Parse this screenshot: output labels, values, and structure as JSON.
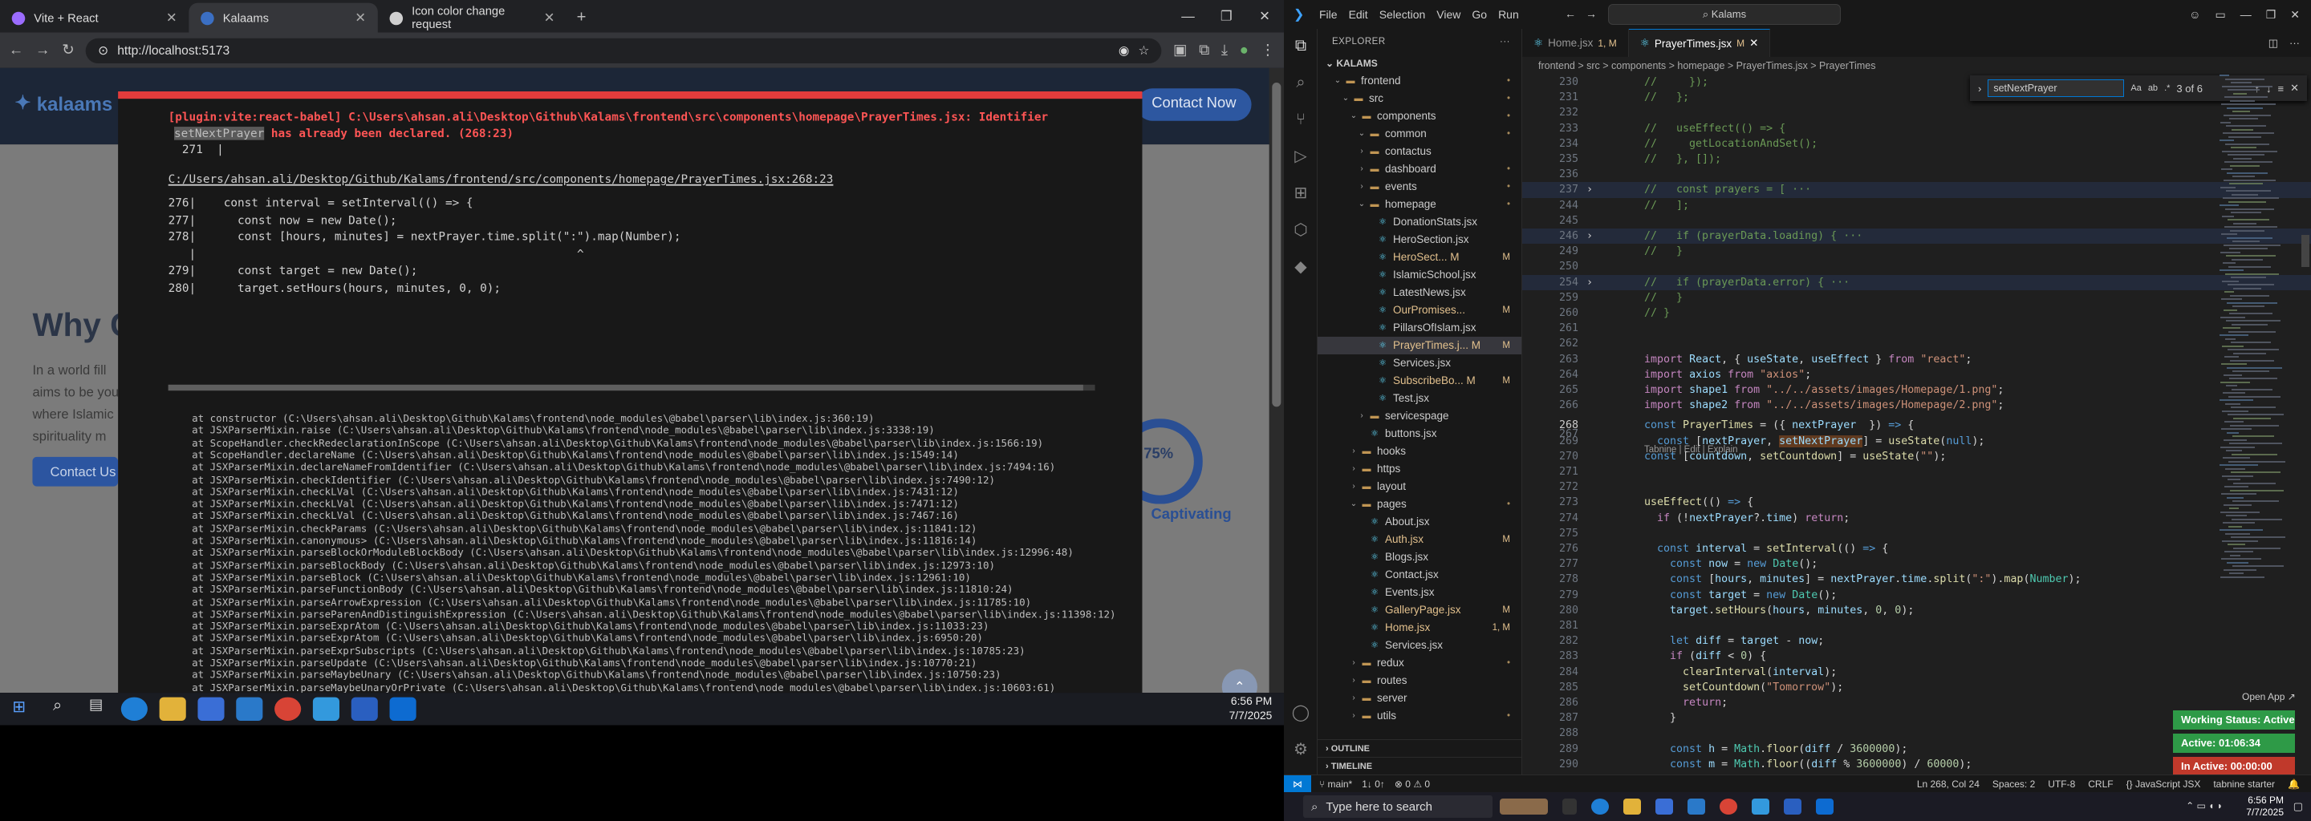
{
  "browser": {
    "tabs": [
      {
        "label": "Vite + React",
        "color": "#9b6cff"
      },
      {
        "label": "Kalaams",
        "color": "#3b6fc3"
      },
      {
        "label": "Icon color change request",
        "color": "#cfcfcf"
      }
    ],
    "url": "http://localhost:5173"
  },
  "site": {
    "logo": "kalaams",
    "contact_button": "Contact Now",
    "hero_title": "Why C",
    "hero_text": "In a world fill aims to be you where Islamic spirituality m",
    "hero_button": "Contact Us",
    "stat_value": "75%",
    "stat_label": "Captivating"
  },
  "overlay": {
    "plugin": "[plugin:vite:react-babel]",
    "path": "C:\\Users\\ahsan.ali\\Desktop\\Github\\Kalams\\frontend\\src\\components\\homepage\\PrayerTimes.jsx:",
    "tail": "Identifier",
    "identifier": "setNextPrayer",
    "msg2": " has already been declared. (268:23)",
    "line271": "  271  |",
    "file_link": "C:/Users/ahsan.ali/Desktop/Github/Kalams/frontend/src/components/homepage/PrayerTimes.jsx:268:23",
    "code": [
      "276|    const interval = setInterval(() => {",
      "277|      const now = new Date();",
      "278|      const [hours, minutes] = nextPrayer.time.split(\":\").map(Number);",
      "   |                                                       ^",
      "279|      const target = new Date();",
      "280|      target.setHours(hours, minutes, 0, 0);"
    ],
    "stack": [
      "at constructor (C:\\Users\\ahsan.ali\\Desktop\\Github\\Kalams\\frontend\\node_modules\\@babel\\parser\\lib\\index.js:360:19)",
      "at JSXParserMixin.raise (C:\\Users\\ahsan.ali\\Desktop\\Github\\Kalams\\frontend\\node_modules\\@babel\\parser\\lib\\index.js:3338:19)",
      "at ScopeHandler.checkRedeclarationInScope (C:\\Users\\ahsan.ali\\Desktop\\Github\\Kalams\\frontend\\node_modules\\@babel\\parser\\lib\\index.js:1566:19)",
      "at ScopeHandler.declareName (C:\\Users\\ahsan.ali\\Desktop\\Github\\Kalams\\frontend\\node_modules\\@babel\\parser\\lib\\index.js:1549:14)",
      "at JSXParserMixin.declareNameFromIdentifier (C:\\Users\\ahsan.ali\\Desktop\\Github\\Kalams\\frontend\\node_modules\\@babel\\parser\\lib\\index.js:7494:16)",
      "at JSXParserMixin.checkIdentifier (C:\\Users\\ahsan.ali\\Desktop\\Github\\Kalams\\frontend\\node_modules\\@babel\\parser\\lib\\index.js:7490:12)",
      "at JSXParserMixin.checkLVal (C:\\Users\\ahsan.ali\\Desktop\\Github\\Kalams\\frontend\\node_modules\\@babel\\parser\\lib\\index.js:7431:12)",
      "at JSXParserMixin.checkLVal (C:\\Users\\ahsan.ali\\Desktop\\Github\\Kalams\\frontend\\node_modules\\@babel\\parser\\lib\\index.js:7471:12)",
      "at JSXParserMixin.checkLVal (C:\\Users\\ahsan.ali\\Desktop\\Github\\Kalams\\frontend\\node_modules\\@babel\\parser\\lib\\index.js:7467:16)",
      "at JSXParserMixin.checkParams (C:\\Users\\ahsan.ali\\Desktop\\Github\\Kalams\\frontend\\node_modules\\@babel\\parser\\lib\\index.js:11841:12)",
      "at JSXParserMixin.canonymous> (C:\\Users\\ahsan.ali\\Desktop\\Github\\Kalams\\frontend\\node_modules\\@babel\\parser\\lib\\index.js:11816:14)",
      "at JSXParserMixin.parseBlockOrModuleBlockBody (C:\\Users\\ahsan.ali\\Desktop\\Github\\Kalams\\frontend\\node_modules\\@babel\\parser\\lib\\index.js:12996:48)",
      "at JSXParserMixin.parseBlockBody (C:\\Users\\ahsan.ali\\Desktop\\Github\\Kalams\\frontend\\node_modules\\@babel\\parser\\lib\\index.js:12973:10)",
      "at JSXParserMixin.parseBlock (C:\\Users\\ahsan.ali\\Desktop\\Github\\Kalams\\frontend\\node_modules\\@babel\\parser\\lib\\index.js:12961:10)",
      "at JSXParserMixin.parseFunctionBody (C:\\Users\\ahsan.ali\\Desktop\\Github\\Kalams\\frontend\\node_modules\\@babel\\parser\\lib\\index.js:11810:24)",
      "at JSXParserMixin.parseArrowExpression (C:\\Users\\ahsan.ali\\Desktop\\Github\\Kalams\\frontend\\node_modules\\@babel\\parser\\lib\\index.js:11785:10)",
      "at JSXParserMixin.parseParenAndDistinguishExpression (C:\\Users\\ahsan.ali\\Desktop\\Github\\Kalams\\frontend\\node_modules\\@babel\\parser\\lib\\index.js:11398:12)",
      "at JSXParserMixin.parseExprAtom (C:\\Users\\ahsan.ali\\Desktop\\Github\\Kalams\\frontend\\node_modules\\@babel\\parser\\lib\\index.js:11033:23)",
      "at JSXParserMixin.parseExprAtom (C:\\Users\\ahsan.ali\\Desktop\\Github\\Kalams\\frontend\\node_modules\\@babel\\parser\\lib\\index.js:6950:20)",
      "at JSXParserMixin.parseExprSubscripts (C:\\Users\\ahsan.ali\\Desktop\\Github\\Kalams\\frontend\\node_modules\\@babel\\parser\\lib\\index.js:10785:23)",
      "at JSXParserMixin.parseUpdate (C:\\Users\\ahsan.ali\\Desktop\\Github\\Kalams\\frontend\\node_modules\\@babel\\parser\\lib\\index.js:10770:21)",
      "at JSXParserMixin.parseMaybeUnary (C:\\Users\\ahsan.ali\\Desktop\\Github\\Kalams\\frontend\\node_modules\\@babel\\parser\\lib\\index.js:10750:23)",
      "at JSXParserMixin.parseMaybeUnaryOrPrivate (C:\\Users\\ahsan.ali\\Desktop\\Github\\Kalams\\frontend\\node_modules\\@babel\\parser\\lib\\index.js:10603:61)"
    ]
  },
  "left_taskbar": {
    "time": "6:56 PM",
    "date": "7/7/2025"
  },
  "vscode": {
    "menu": [
      "File",
      "Edit",
      "Selection",
      "View",
      "Go",
      "Run"
    ],
    "search": "Kalams",
    "explorer_title": "EXPLORER",
    "root": "KALAMS",
    "tree": [
      {
        "label": "frontend",
        "depth": 1,
        "type": "folder-open",
        "badge": "•"
      },
      {
        "label": "src",
        "depth": 2,
        "type": "folder-open",
        "badge": "•"
      },
      {
        "label": "components",
        "depth": 3,
        "type": "folder-open",
        "badge": "•"
      },
      {
        "label": "common",
        "depth": 4,
        "type": "folder-open",
        "badge": "•"
      },
      {
        "label": "contactus",
        "depth": 4,
        "type": "folder",
        "badge": ""
      },
      {
        "label": "dashboard",
        "depth": 4,
        "type": "folder",
        "badge": "•"
      },
      {
        "label": "events",
        "depth": 4,
        "type": "folder",
        "badge": "•"
      },
      {
        "label": "homepage",
        "depth": 4,
        "type": "folder-open",
        "badge": "•"
      },
      {
        "label": "DonationStats.jsx",
        "depth": 5,
        "type": "file",
        "badge": ""
      },
      {
        "label": "HeroSection.jsx",
        "depth": 5,
        "type": "file",
        "badge": ""
      },
      {
        "label": "HeroSect... M",
        "depth": 5,
        "type": "file",
        "badge": "M"
      },
      {
        "label": "IslamicSchool.jsx",
        "depth": 5,
        "type": "file",
        "badge": ""
      },
      {
        "label": "LatestNews.jsx",
        "depth": 5,
        "type": "file",
        "badge": ""
      },
      {
        "label": "OurPromises...",
        "depth": 5,
        "type": "file",
        "badge": "M"
      },
      {
        "label": "PillarsOfIslam.jsx",
        "depth": 5,
        "type": "file",
        "badge": ""
      },
      {
        "label": "PrayerTimes.j... M",
        "depth": 5,
        "type": "file",
        "badge": "M",
        "selected": true
      },
      {
        "label": "Services.jsx",
        "depth": 5,
        "type": "file",
        "badge": ""
      },
      {
        "label": "SubscribeBo... M",
        "depth": 5,
        "type": "file",
        "badge": "M"
      },
      {
        "label": "Test.jsx",
        "depth": 5,
        "type": "file",
        "badge": ""
      },
      {
        "label": "servicespage",
        "depth": 4,
        "type": "folder",
        "badge": ""
      },
      {
        "label": "buttons.jsx",
        "depth": 4,
        "type": "file",
        "badge": ""
      },
      {
        "label": "hooks",
        "depth": 3,
        "type": "folder",
        "badge": ""
      },
      {
        "label": "https",
        "depth": 3,
        "type": "folder",
        "badge": ""
      },
      {
        "label": "layout",
        "depth": 3,
        "type": "folder",
        "badge": ""
      },
      {
        "label": "pages",
        "depth": 3,
        "type": "folder-open",
        "badge": "•"
      },
      {
        "label": "About.jsx",
        "depth": 4,
        "type": "file",
        "badge": ""
      },
      {
        "label": "Auth.jsx",
        "depth": 4,
        "type": "file",
        "badge": "M"
      },
      {
        "label": "Blogs.jsx",
        "depth": 4,
        "type": "file",
        "badge": ""
      },
      {
        "label": "Contact.jsx",
        "depth": 4,
        "type": "file",
        "badge": ""
      },
      {
        "label": "Events.jsx",
        "depth": 4,
        "type": "file",
        "badge": ""
      },
      {
        "label": "GalleryPage.jsx",
        "depth": 4,
        "type": "file",
        "badge": "M"
      },
      {
        "label": "Home.jsx",
        "depth": 4,
        "type": "file",
        "badge": "1, M"
      },
      {
        "label": "Services.jsx",
        "depth": 4,
        "type": "file",
        "badge": ""
      },
      {
        "label": "redux",
        "depth": 3,
        "type": "folder",
        "badge": "•"
      },
      {
        "label": "routes",
        "depth": 3,
        "type": "folder",
        "badge": ""
      },
      {
        "label": "server",
        "depth": 3,
        "type": "folder",
        "badge": ""
      },
      {
        "label": "utils",
        "depth": 3,
        "type": "folder",
        "badge": "•"
      }
    ],
    "outline": "OUTLINE",
    "timeline": "TIMELINE",
    "tabs": [
      {
        "label": "Home.jsx",
        "mod": "1, M",
        "active": false
      },
      {
        "label": "PrayerTimes.jsx",
        "mod": "M",
        "active": true
      }
    ],
    "breadcrumb": "frontend > src > components > homepage > PrayerTimes.jsx > PrayerTimes",
    "find": {
      "query": "setNextPrayer",
      "count": "3 of 6"
    },
    "codelens": "Tabnine | Edit | Explain",
    "status": {
      "branch": "main*",
      "sync": "1↓ 0↑",
      "problems": "⊗ 0 ⚠ 0",
      "position": "Ln 268, Col 24",
      "spaces": "Spaces: 2",
      "encoding": "UTF-8",
      "eol": "CRLF",
      "language": "{} JavaScript JSX",
      "tabnine": "tabnine starter"
    },
    "open_app": "Open App ↗",
    "working_status": "Working Status: Active",
    "active_time": "Active: 01:06:34",
    "inactive_time": "In Active: 00:00:00"
  },
  "right_taskbar": {
    "search_placeholder": "Type here to search",
    "time": "6:56 PM",
    "date": "7/7/2025"
  }
}
